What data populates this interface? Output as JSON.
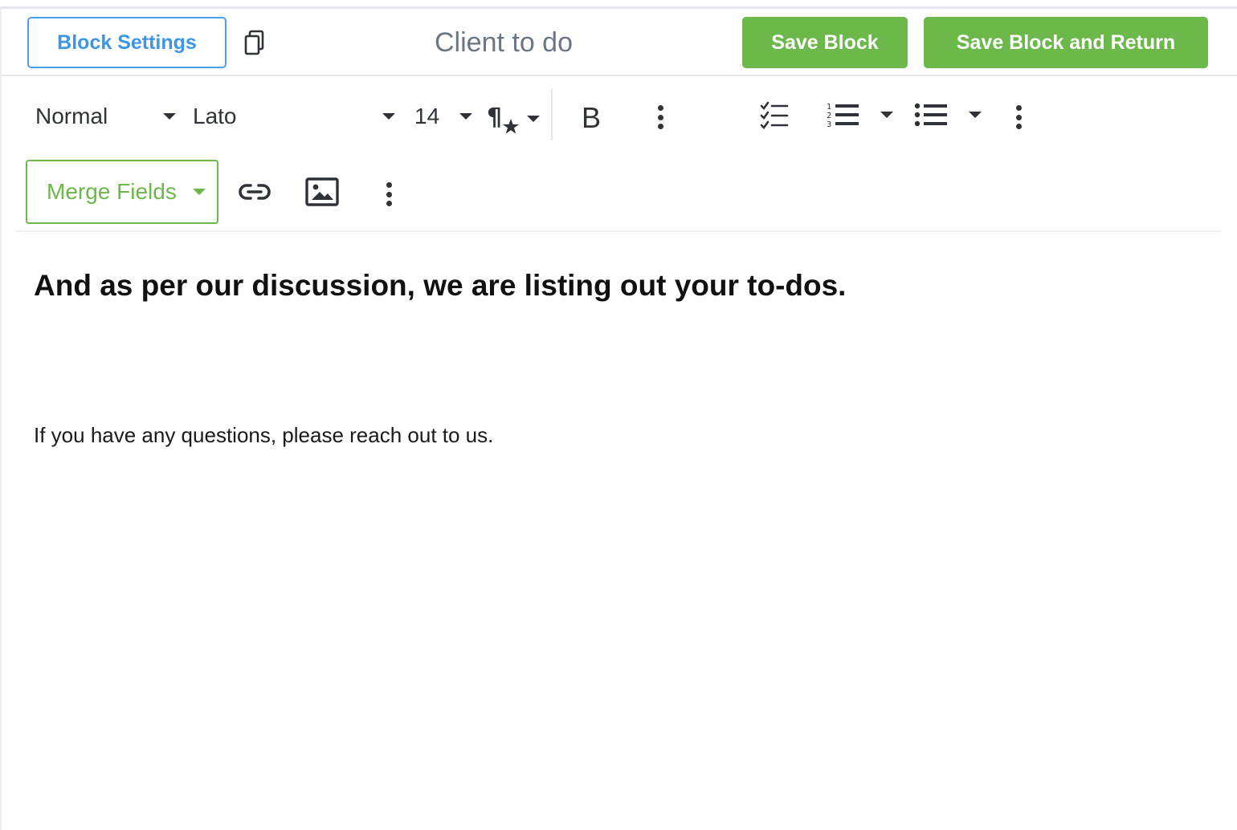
{
  "header": {
    "settings_label": "Block Settings",
    "copy_icon": "copy-icon",
    "title": "Client to do",
    "save_label": "Save Block",
    "save_return_label": "Save Block and Return"
  },
  "toolbar": {
    "style_value": "Normal",
    "font_value": "Lato",
    "size_value": "14",
    "paragraph_format_icon": "paragraph-format-icon",
    "bold_label": "B",
    "more_text_icon": "more-vertical-icon",
    "checklist_icon": "checklist-icon",
    "ordered_list_icon": "ordered-list-icon",
    "unordered_list_icon": "unordered-list-icon",
    "more_paragraph_icon": "more-vertical-icon",
    "merge_fields_label": "Merge Fields",
    "link_icon": "link-icon",
    "image_icon": "image-icon",
    "more_rich_icon": "more-vertical-icon"
  },
  "editor": {
    "heading": "And as per our discussion, we are listing out your to-dos.",
    "paragraph": "If you have any questions, please reach out to us."
  },
  "colors": {
    "accent_blue": "#3d95e4",
    "accent_green": "#6cb84a",
    "title_gray": "#6b7683"
  }
}
